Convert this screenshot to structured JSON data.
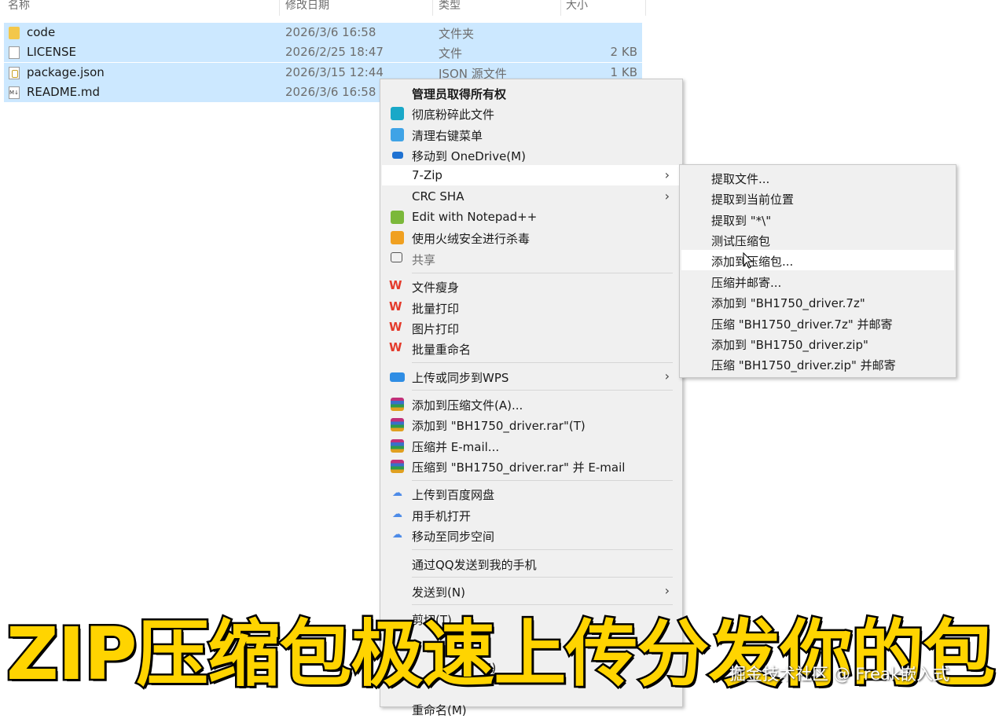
{
  "columns": {
    "name": "名称",
    "modified": "修改日期",
    "type": "类型",
    "size": "大小"
  },
  "files": [
    {
      "icon": "folder-icon",
      "name": "code",
      "modified": "2026/3/6 16:58",
      "type": "文件夹",
      "size": ""
    },
    {
      "icon": "file-icon",
      "name": "LICENSE",
      "modified": "2026/2/25 18:47",
      "type": "文件",
      "size": "2 KB"
    },
    {
      "icon": "json-file-icon",
      "name": "package.json",
      "modified": "2026/3/15 12:44",
      "type": "JSON 源文件",
      "size": "1 KB"
    },
    {
      "icon": "markdown-file-icon",
      "name": "README.md",
      "modified": "2026/3/6 16:58",
      "type": "",
      "size": ""
    }
  ],
  "menu": {
    "take_ownership": "管理员取得所有权",
    "shred": "彻底粉碎此文件",
    "clean_menu": "清理右键菜单",
    "onedrive": "移动到 OneDrive(M)",
    "sevenzip": "7-Zip",
    "crc": "CRC SHA",
    "notepadpp": "Edit with Notepad++",
    "huorong": "使用火绒安全进行杀毒",
    "share": "共享",
    "wps_slim": "文件瘦身",
    "wps_batch_print": "批量打印",
    "wps_image_print": "图片打印",
    "wps_batch_rename": "批量重命名",
    "wps_upload": "上传或同步到WPS",
    "rar_add": "添加到压缩文件(A)...",
    "rar_add_named": "添加到 \"BH1750_driver.rar\"(T)",
    "rar_email": "压缩并 E-mail...",
    "rar_email_named": "压缩到 \"BH1750_driver.rar\" 并 E-mail",
    "baidu_upload": "上传到百度网盘",
    "baidu_phone": "用手机打开",
    "baidu_sync": "移动至同步空间",
    "qq_send": "通过QQ发送到我的手机",
    "send_to": "发送到(N)",
    "cut": "剪切(T)",
    "copy_partial": "S)",
    "rename_partial": "重命名(M)"
  },
  "submenu": {
    "extract": "提取文件...",
    "extract_here": "提取到当前位置",
    "extract_to": "提取到 \"*\\\"",
    "test": "测试压缩包",
    "add_archive": "添加到压缩包...",
    "compress_email": "压缩并邮寄...",
    "add_7z": "添加到 \"BH1750_driver.7z\"",
    "compress_7z_email": "压缩 \"BH1750_driver.7z\" 并邮寄",
    "add_zip": "添加到 \"BH1750_driver.zip\"",
    "compress_zip_email": "压缩 \"BH1750_driver.zip\" 并邮寄"
  },
  "caption": "ZIP压缩包极速上传分发你的包",
  "watermark": "掘金技术社区 @ Freak嵌入式",
  "colors": {
    "selection": "#cce8ff",
    "menu_bg": "#f0f0f0",
    "caption_fill": "#ffd400",
    "wps_red": "#e43b2c"
  }
}
